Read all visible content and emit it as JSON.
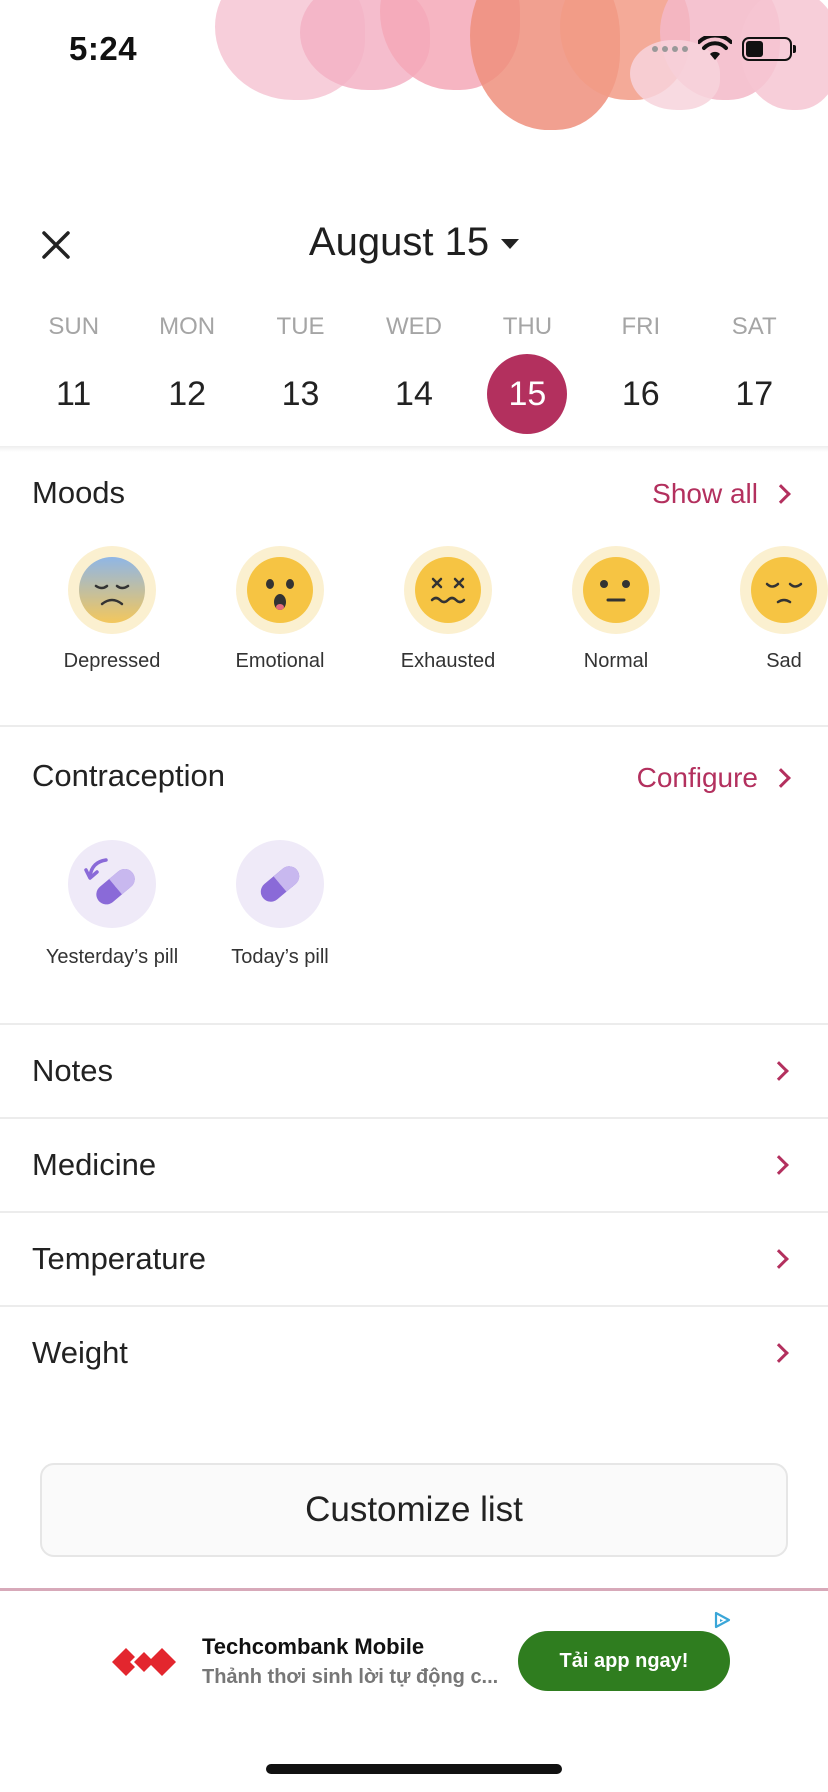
{
  "status_bar": {
    "time": "5:24"
  },
  "header": {
    "date_title": "August 15"
  },
  "week": [
    {
      "name": "SUN",
      "num": "11",
      "selected": false
    },
    {
      "name": "MON",
      "num": "12",
      "selected": false
    },
    {
      "name": "TUE",
      "num": "13",
      "selected": false
    },
    {
      "name": "WED",
      "num": "14",
      "selected": false
    },
    {
      "name": "THU",
      "num": "15",
      "selected": true
    },
    {
      "name": "FRI",
      "num": "16",
      "selected": false
    },
    {
      "name": "SAT",
      "num": "17",
      "selected": false
    }
  ],
  "moods": {
    "title": "Moods",
    "link": "Show all",
    "items": [
      {
        "label": "Depressed",
        "icon": "depressed-face-icon"
      },
      {
        "label": "Emotional",
        "icon": "emotional-face-icon"
      },
      {
        "label": "Exhausted",
        "icon": "exhausted-face-icon"
      },
      {
        "label": "Normal",
        "icon": "normal-face-icon"
      },
      {
        "label": "Sad",
        "icon": "sad-face-icon"
      }
    ]
  },
  "contraception": {
    "title": "Contraception",
    "link": "Configure",
    "items": [
      {
        "label": "Yesterday’s pill",
        "icon": "pill-undo-icon"
      },
      {
        "label": "Today’s pill",
        "icon": "pill-icon"
      }
    ]
  },
  "rows": [
    {
      "label": "Notes"
    },
    {
      "label": "Medicine"
    },
    {
      "label": "Temperature"
    },
    {
      "label": "Weight"
    }
  ],
  "customize_button": "Customize list",
  "ad": {
    "title": "Techcombank Mobile",
    "subtitle": "Thảnh thơi sinh lời tự động c...",
    "cta": "Tải app ngay!"
  },
  "colors": {
    "accent": "#b3305e",
    "pill_purple": "#8a6ad8",
    "ad_green": "#2f7d1f",
    "ad_red": "#e3262e"
  }
}
